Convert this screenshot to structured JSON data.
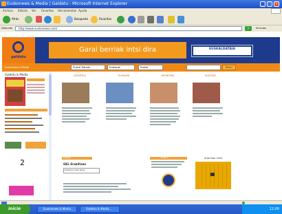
{
  "window": {
    "title": "Euskonews & Media | Galdetu - Microsoft Internet Explorer",
    "controls": [
      "min",
      "max",
      "close"
    ]
  },
  "menu": {
    "items": [
      "Archivo",
      "Edición",
      "Ver",
      "Favoritos",
      "Herramientas",
      "Ayuda"
    ]
  },
  "toolbar": {
    "back_label": "Atrás",
    "search_label": "Búsqueda",
    "favorites_label": "Favoritos"
  },
  "address": {
    "label": "Dirección",
    "url": "http://www.euskonews.com/",
    "go_label": "Ir",
    "links_label": "Vínculos"
  },
  "site": {
    "logo_text": "galdetu",
    "slogan": "Garai berriak intsi dira",
    "ad_label": "EUSKALDATAIA",
    "search": {
      "select1": "Euskal Datuak",
      "select2": "Euskarak",
      "select3": "Euskal",
      "button": "Bilatu"
    },
    "left_header": "Euskonews & Media",
    "sidebar_header": "Galdetu & Media",
    "sidebar_number": "2",
    "articles": [
      {
        "title": "GIZARTEA",
        "thumb_color": "#9a7b5a"
      },
      {
        "title": "EUSKARA",
        "thumb_color": "#6a8fc0"
      },
      {
        "title": "EKONOMIA",
        "thumb_color": "#c8906a"
      },
      {
        "title": "KULTURA",
        "thumb_color": "#a05a4a"
      }
    ],
    "poll": {
      "header": "Inkesta",
      "question": "GKL Erabiltzen",
      "answer": "Euskara oinarrizkoa"
    },
    "agenda_header": "Bi Berri",
    "calendar_header": "Urtarriloa 2004",
    "calendar_color": "#e8a800"
  },
  "taskbar": {
    "start": "inicio",
    "tasks": [
      "Euskonews & Media...",
      "Galdetu & Media..."
    ],
    "clock": "12:00"
  }
}
